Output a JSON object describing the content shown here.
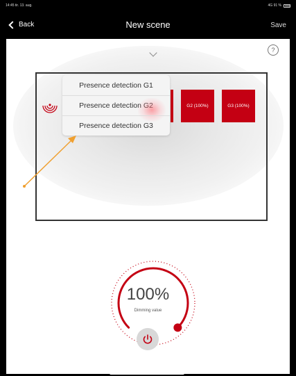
{
  "status_bar": {
    "time_date": "14:45  tir. 13. aug.",
    "signal": "4G 91 %"
  },
  "nav": {
    "back_label": "Back",
    "title": "New scene",
    "save_label": "Save"
  },
  "help": {
    "label": "?"
  },
  "dropdown": {
    "items": [
      {
        "label": "Presence detection G1"
      },
      {
        "label": "Presence detection G2",
        "selected": true
      },
      {
        "label": "Presence detection G3"
      }
    ]
  },
  "groups": [
    {
      "label": "G2 (100%)"
    },
    {
      "label": "G3 (100%)"
    }
  ],
  "dimming": {
    "value": "100%",
    "label": "Dimming value",
    "level": 1.0
  },
  "colors": {
    "accent_red": "#c40013",
    "annotation_orange": "#f0a030"
  }
}
